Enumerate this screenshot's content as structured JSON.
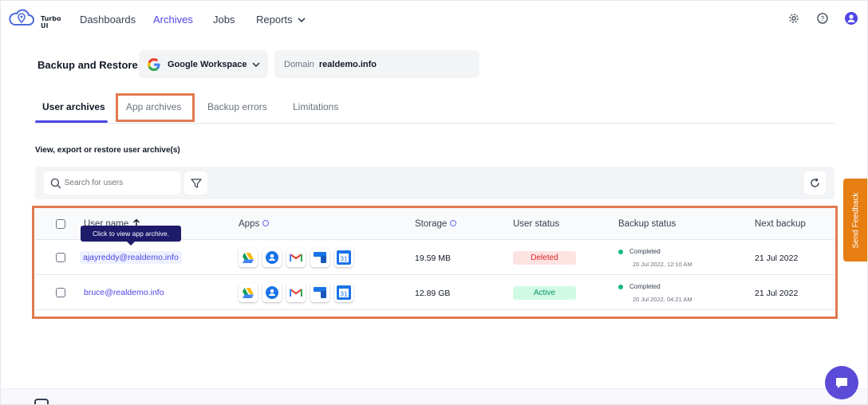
{
  "app": {
    "logo_text": "Turbo UI"
  },
  "nav": {
    "items": [
      {
        "label": "Dashboards"
      },
      {
        "label": "Archives"
      },
      {
        "label": "Jobs"
      },
      {
        "label": "Reports"
      }
    ],
    "active": "Archives"
  },
  "header": {
    "title": "Backup and Restore",
    "provider": "Google Workspace",
    "domain_label": "Domain",
    "domain_value": "realdemo.info"
  },
  "tabs": [
    {
      "label": "User archives"
    },
    {
      "label": "App archives"
    },
    {
      "label": "Backup errors"
    },
    {
      "label": "Limitations"
    }
  ],
  "subtitle": "View, export or restore user archive(s)",
  "search": {
    "placeholder": "Search for users"
  },
  "table": {
    "columns": {
      "user": "User name",
      "apps": "Apps",
      "storage": "Storage",
      "user_status": "User status",
      "backup_status": "Backup status",
      "next_backup": "Next backup"
    },
    "rows": [
      {
        "email": "ajayreddy@realdemo.info",
        "storage": "19.59 MB",
        "user_status": "Deleted",
        "backup_status": "Completed",
        "backup_time": "20 Jul 2022, 12:10 AM",
        "next_backup": "21 Jul 2022"
      },
      {
        "email": "bruce@realdemo.info",
        "storage": "12.89 GB",
        "user_status": "Active",
        "backup_status": "Completed",
        "backup_time": "20 Jul 2022, 04:21 AM",
        "next_backup": "21 Jul 2022"
      }
    ],
    "app_icons": [
      "drive-icon",
      "contacts-icon",
      "gmail-icon",
      "tasks-icon",
      "calendar-icon"
    ],
    "calendar_day": "31"
  },
  "tooltip": "Click to view app archive.",
  "feedback": "Send Feedback",
  "colors": {
    "accent": "#4f46e5",
    "highlight": "#e07a50",
    "feedback": "#e67e12",
    "chat": "#5b4bd8"
  }
}
